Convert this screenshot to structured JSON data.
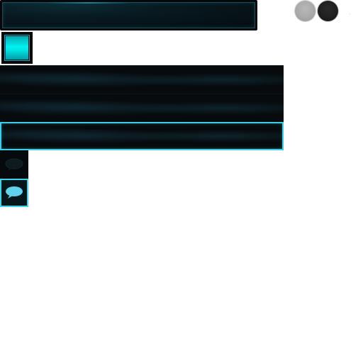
{
  "search_field": {
    "icon": "text-field-frame",
    "value": ""
  },
  "toggle_knobs": [
    {
      "name": "light-knob-icon",
      "color": "#a8a8a8"
    },
    {
      "name": "dark-knob-icon",
      "color": "#1c1c1c"
    }
  ],
  "action_button": {
    "icon": "cyan-square",
    "color": "#00f0ef",
    "state": "active"
  },
  "list_rows": [
    {
      "state": "normal"
    },
    {
      "state": "normal"
    },
    {
      "state": "selected",
      "highlight_color": "#37d0e6"
    }
  ],
  "chat_buttons": [
    {
      "icon": "speech-bubble-icon",
      "state": "inactive",
      "color": "#16262b"
    },
    {
      "icon": "speech-bubble-icon",
      "state": "active",
      "color": "#5fd3ee"
    }
  ],
  "theme": {
    "accent": "#00f0ef",
    "panel_dark": "#070b0d",
    "border_highlight": "#37d0e6"
  }
}
